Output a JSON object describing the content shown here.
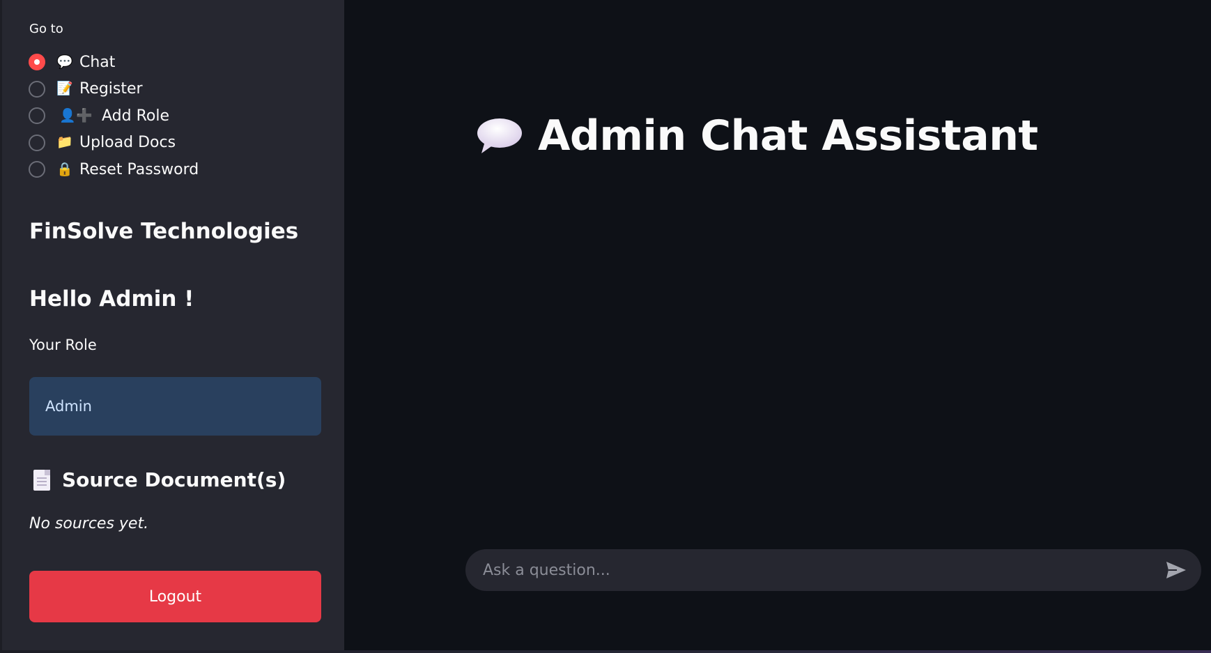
{
  "sidebar": {
    "goto_label": "Go to",
    "nav": [
      {
        "emoji": "💬",
        "label": "Chat",
        "selected": true
      },
      {
        "emoji": "📝",
        "label": "Register",
        "selected": false
      },
      {
        "emoji": "👤➕",
        "label": "Add Role",
        "selected": false
      },
      {
        "emoji": "📁",
        "label": "Upload Docs",
        "selected": false
      },
      {
        "emoji": "🔒",
        "label": "Reset Password",
        "selected": false
      }
    ],
    "org_name": "FinSolve Technologies",
    "greeting": "Hello Admin !",
    "role_label": "Your Role",
    "role_value": "Admin",
    "sources_title": "Source Document(s)",
    "sources_empty": "No sources yet.",
    "logout_label": "Logout"
  },
  "main": {
    "title": "Admin Chat Assistant",
    "chat_placeholder": "Ask a question..."
  },
  "colors": {
    "accent": "#ff4b4b",
    "logout": "#e63946",
    "role_box": "#29405e",
    "sidebar_bg": "#262730",
    "main_bg": "#0e1117"
  }
}
